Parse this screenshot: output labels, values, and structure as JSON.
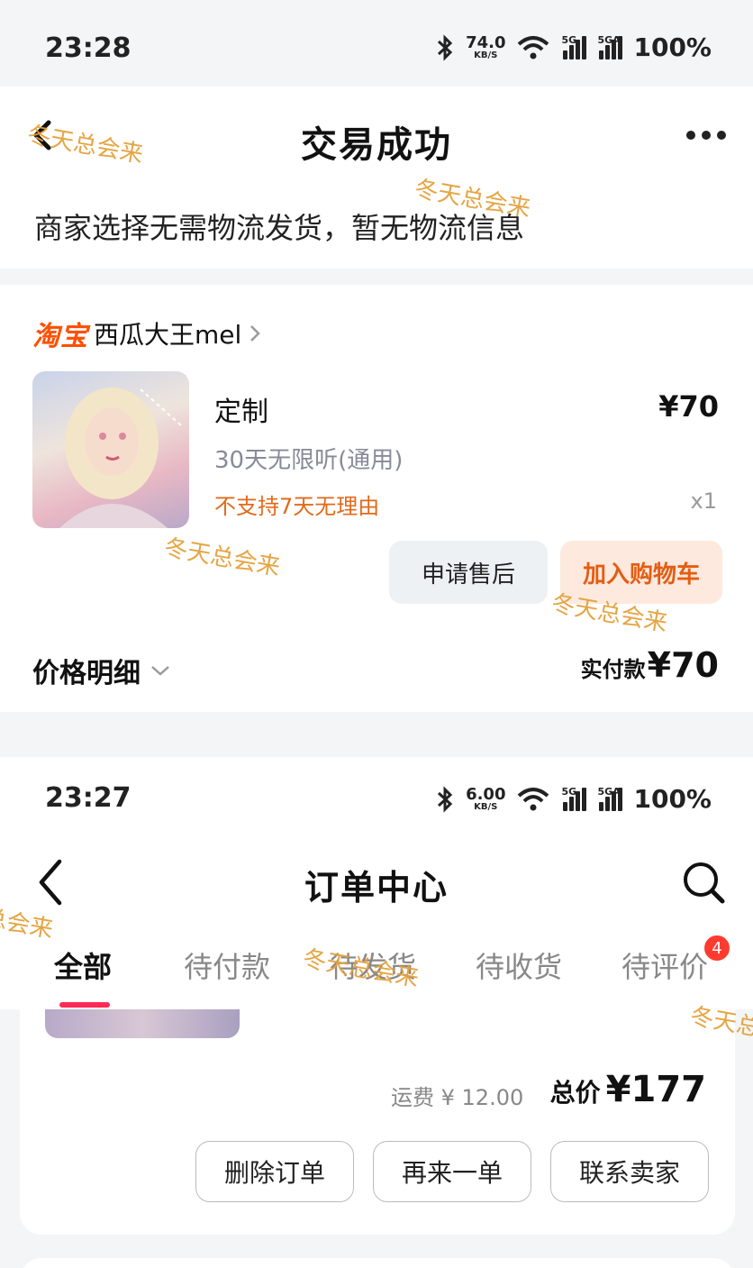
{
  "top_screen": {
    "status_bar": {
      "time": "23:28",
      "net_speed": "74.0",
      "net_unit": "KB/S",
      "sim1": "5G",
      "sim2": "5GA",
      "battery": "100%"
    },
    "header": {
      "title": "交易成功"
    },
    "logistics_text": "商家选择无需物流发货，暂无物流信息",
    "shop": {
      "platform": "淘宝",
      "name": "西瓜大王mel"
    },
    "item": {
      "name": "定制",
      "price": "¥70",
      "spec": "30天无限听(通用)",
      "policy": "不支持7天无理由",
      "qty": "x1"
    },
    "buttons": {
      "after_sale": "申请售后",
      "add_cart": "加入购物车"
    },
    "price_detail": {
      "label": "价格明细",
      "paid_label": "实付款",
      "paid_amount": "¥70"
    }
  },
  "bottom_screen": {
    "status_bar": {
      "time": "23:27",
      "net_speed": "6.00",
      "net_unit": "KB/S",
      "sim1": "5G",
      "sim2": "5GA",
      "battery": "100%"
    },
    "header": {
      "title": "订单中心"
    },
    "tabs": [
      {
        "label": "全部",
        "active": true
      },
      {
        "label": "待付款"
      },
      {
        "label": "待发货"
      },
      {
        "label": "待收货"
      },
      {
        "label": "待评价",
        "badge": "4"
      }
    ],
    "order": {
      "shipping": "运费 ¥ 12.00",
      "total_label": "总价",
      "total_amount": "¥177",
      "actions": [
        "删除订单",
        "再来一单",
        "联系卖家"
      ]
    }
  },
  "watermark": "冬天总会来",
  "colors": {
    "taobao": "#ff5000",
    "accent_orange": "#e35d14",
    "tab_underline": "#ff2a55",
    "badge": "#ff3b30",
    "watermark": "#e4a13b"
  }
}
